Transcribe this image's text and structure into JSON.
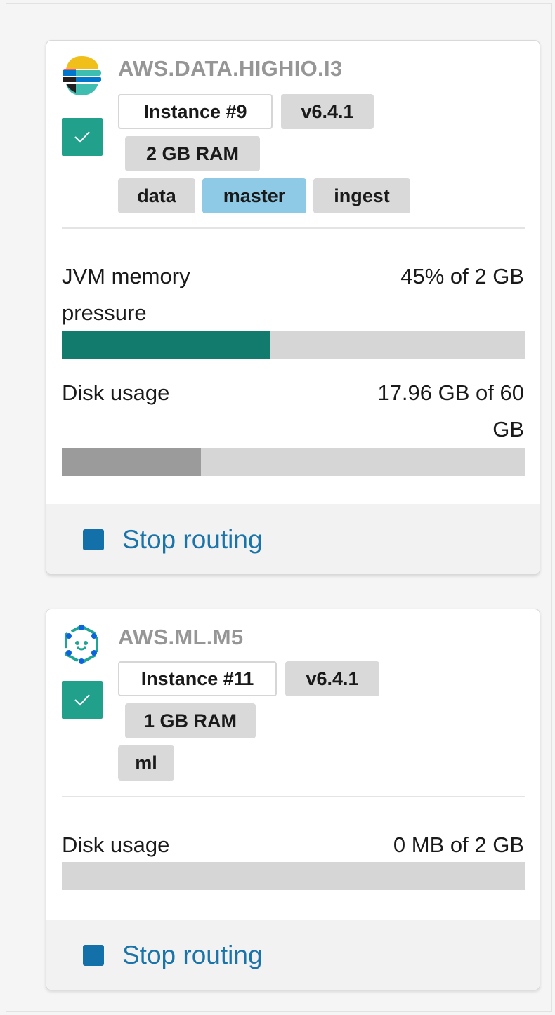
{
  "nodes": [
    {
      "title": "AWS.DATA.HIGHIO.I3",
      "logo_icon": "elasticsearch-logo-icon",
      "checkbox_checked": true,
      "instance": "Instance #9",
      "version": "v6.4.1",
      "ram": "2 GB RAM",
      "roles": [
        "data",
        "master",
        "ingest"
      ],
      "highlighted_role": "master",
      "jvm": {
        "label_line1": "JVM memory",
        "label_line2": "pressure",
        "value": "45% of 2 GB",
        "percent": 45,
        "color": "#127b6e"
      },
      "disk": {
        "label": "Disk usage",
        "value_line1": "17.96 GB of 60",
        "value_line2": "GB",
        "used_gb": 17.96,
        "total_gb": 60,
        "color": "#9b9b9b"
      },
      "stop_routing_label": "Stop routing"
    },
    {
      "title": "AWS.ML.M5",
      "logo_icon": "machine-learning-logo-icon",
      "checkbox_checked": true,
      "instance": "Instance #11",
      "version": "v6.4.1",
      "ram": "1 GB RAM",
      "roles": [
        "ml"
      ],
      "disk": {
        "label": "Disk usage",
        "value": "0 MB of 2 GB",
        "used_gb": 0,
        "total_gb": 2,
        "color": "#9b9b9b"
      },
      "stop_routing_label": "Stop routing"
    }
  ],
  "colors": {
    "accent_teal": "#21a08c",
    "title_gray": "#969696",
    "link_blue": "#1b74a9",
    "highlight_role": "#8ecae6"
  }
}
